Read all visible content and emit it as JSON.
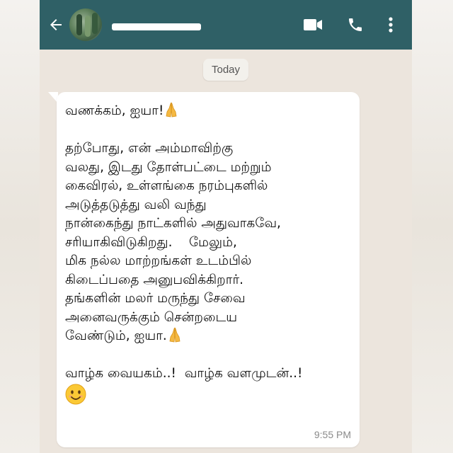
{
  "header": {
    "contact_name_redacted": true,
    "icons": [
      "back-arrow-icon",
      "avatar",
      "video-call-icon",
      "phone-icon",
      "more-vert-icon"
    ]
  },
  "date_chip": "Today",
  "message": {
    "lines": [
      "வணக்கம், ஐயா!",
      "",
      "தற்போது, என் அம்மாவிற்கு",
      "வலது, இடது தோள்பட்டை மற்றும்",
      "கைவிரல், உள்ளங்கை நரம்புகளில்",
      "அடுத்தடுத்து  வலி வந்து",
      "நான்கைந்து நாட்களில் அதுவாகவே,",
      "சரியாகிவிடுகிறது.    மேலும்,",
      "மிக நல்ல மாற்றங்கள் உடம்பில்",
      "கிடைப்பதை அனுபவிக்கிறார்.",
      "தங்களின் மலர் மருந்து சேவை",
      "அனைவருக்கும் சென்றடைய",
      "வேண்டும், ஐயா.",
      "",
      "வாழ்க வையகம்..!  வாழ்க வளமுடன்..!"
    ],
    "time": "9:55 PM"
  },
  "colors": {
    "header_bg": "#2f6066",
    "chat_bg": "#ece5dd",
    "bubble_bg": "#ffffff",
    "time_color": "#8a8a8a"
  }
}
